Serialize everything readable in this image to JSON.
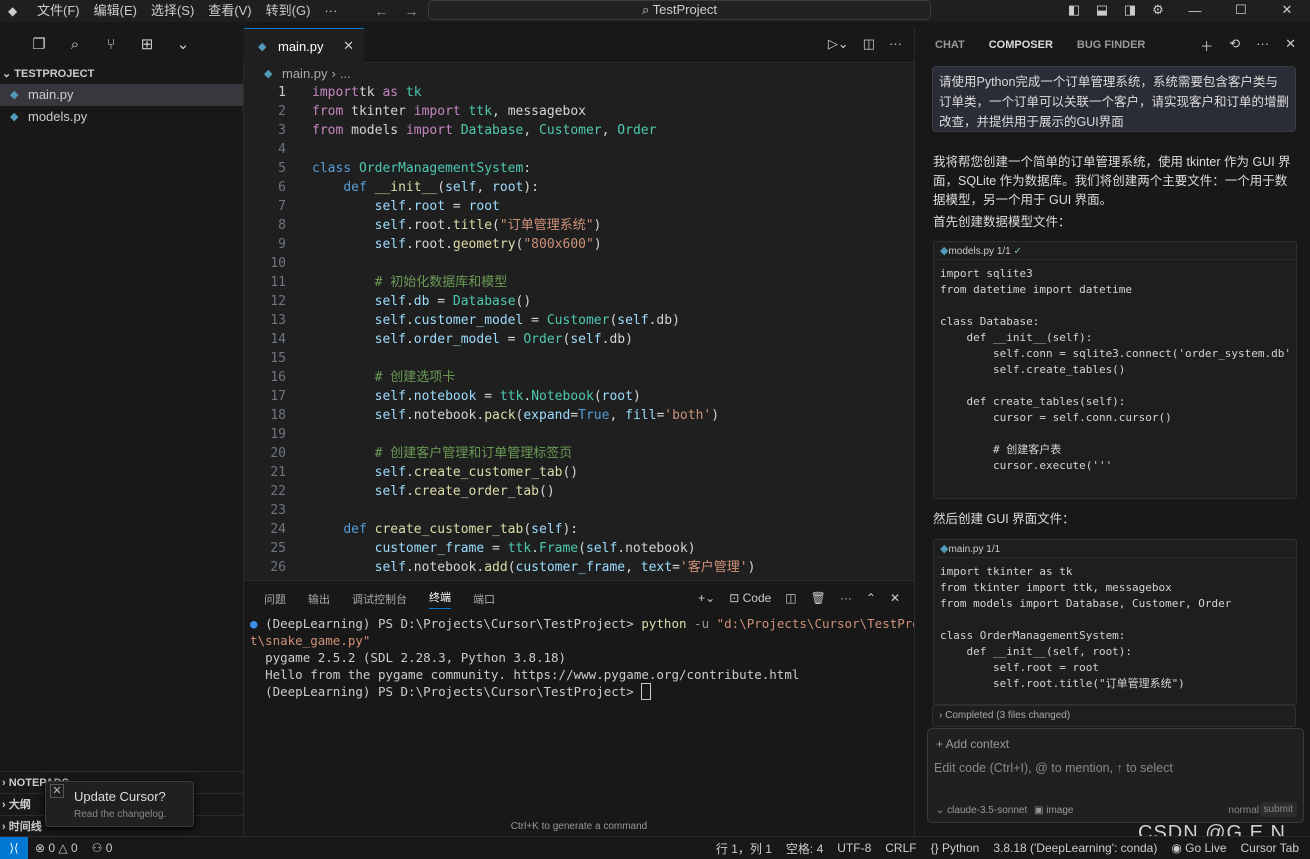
{
  "titlebar": {
    "menus": [
      "文件(F)",
      "编辑(E)",
      "选择(S)",
      "查看(V)",
      "转到(G)",
      "···"
    ],
    "search": "TestProject"
  },
  "sidebar": {
    "title": "TESTPROJECT",
    "files": [
      "main.py",
      "models.py"
    ],
    "sections": [
      "NOTEPADS",
      "大纲",
      "时间线"
    ]
  },
  "toast": {
    "title": "Update Cursor?",
    "subtitle": "Read the changelog."
  },
  "editor": {
    "tab": "main.py",
    "breadcrumb": "main.py",
    "breadcrumb_more": "...",
    "lines": [
      [
        [
          "kw",
          "import"
        ],
        [
          "",
          "tk"
        ],
        [
          "kw",
          " as"
        ],
        [
          "cls",
          " tk"
        ]
      ],
      [
        [
          "kw",
          "from"
        ],
        [
          "",
          " tkinter "
        ],
        [
          "kw",
          "import"
        ],
        [
          "cls",
          " ttk"
        ],
        [
          "",
          ", messagebox"
        ]
      ],
      [
        [
          "kw",
          "from"
        ],
        [
          "",
          " models "
        ],
        [
          "kw",
          "import"
        ],
        [
          "cls",
          " Database"
        ],
        [
          "",
          ", "
        ],
        [
          "cls",
          "Customer"
        ],
        [
          "",
          ", "
        ],
        [
          "cls",
          "Order"
        ]
      ],
      [],
      [
        [
          "kw2",
          "class"
        ],
        [
          "cls",
          " OrderManagementSystem"
        ],
        [
          "",
          ":"
        ]
      ],
      [
        [
          "",
          "    "
        ],
        [
          "kw2",
          "def"
        ],
        [
          "fn",
          " __init__"
        ],
        [
          "",
          "("
        ],
        [
          "var",
          "self"
        ],
        [
          "",
          ", "
        ],
        [
          "var",
          "root"
        ],
        [
          "",
          "):"
        ]
      ],
      [
        [
          "",
          "        "
        ],
        [
          "var",
          "self"
        ],
        [
          "",
          "."
        ],
        [
          "var",
          "root"
        ],
        [
          "",
          " = "
        ],
        [
          "var",
          "root"
        ]
      ],
      [
        [
          "",
          "        "
        ],
        [
          "var",
          "self"
        ],
        [
          "",
          ".root."
        ],
        [
          "fn",
          "title"
        ],
        [
          "",
          "("
        ],
        [
          "str",
          "\"订单管理系统\""
        ],
        [
          "",
          ")"
        ]
      ],
      [
        [
          "",
          "        "
        ],
        [
          "var",
          "self"
        ],
        [
          "",
          ".root."
        ],
        [
          "fn",
          "geometry"
        ],
        [
          "",
          "("
        ],
        [
          "str",
          "\"800x600\""
        ],
        [
          "",
          ")"
        ]
      ],
      [],
      [
        [
          "",
          "        "
        ],
        [
          "cm",
          "# 初始化数据库和模型"
        ]
      ],
      [
        [
          "",
          "        "
        ],
        [
          "var",
          "self"
        ],
        [
          "",
          "."
        ],
        [
          "var",
          "db"
        ],
        [
          "",
          " = "
        ],
        [
          "cls",
          "Database"
        ],
        [
          "",
          "()"
        ]
      ],
      [
        [
          "",
          "        "
        ],
        [
          "var",
          "self"
        ],
        [
          "",
          "."
        ],
        [
          "var",
          "customer_model"
        ],
        [
          "",
          " = "
        ],
        [
          "cls",
          "Customer"
        ],
        [
          "",
          "("
        ],
        [
          "var",
          "self"
        ],
        [
          "",
          ".db)"
        ]
      ],
      [
        [
          "",
          "        "
        ],
        [
          "var",
          "self"
        ],
        [
          "",
          "."
        ],
        [
          "var",
          "order_model"
        ],
        [
          "",
          " = "
        ],
        [
          "cls",
          "Order"
        ],
        [
          "",
          "("
        ],
        [
          "var",
          "self"
        ],
        [
          "",
          ".db)"
        ]
      ],
      [],
      [
        [
          "",
          "        "
        ],
        [
          "cm",
          "# 创建选项卡"
        ]
      ],
      [
        [
          "",
          "        "
        ],
        [
          "var",
          "self"
        ],
        [
          "",
          "."
        ],
        [
          "var",
          "notebook"
        ],
        [
          "",
          " = "
        ],
        [
          "cls",
          "ttk"
        ],
        [
          "",
          "."
        ],
        [
          "cls",
          "Notebook"
        ],
        [
          "",
          "("
        ],
        [
          "var",
          "root"
        ],
        [
          "",
          ")"
        ]
      ],
      [
        [
          "",
          "        "
        ],
        [
          "var",
          "self"
        ],
        [
          "",
          ".notebook."
        ],
        [
          "fn",
          "pack"
        ],
        [
          "",
          "("
        ],
        [
          "var",
          "expand"
        ],
        [
          "",
          "="
        ],
        [
          "kw2",
          "True"
        ],
        [
          "",
          ", "
        ],
        [
          "var",
          "fill"
        ],
        [
          "",
          "="
        ],
        [
          "str",
          "'both'"
        ],
        [
          "",
          ")"
        ]
      ],
      [],
      [
        [
          "",
          "        "
        ],
        [
          "cm",
          "# 创建客户管理和订单管理标签页"
        ]
      ],
      [
        [
          "",
          "        "
        ],
        [
          "var",
          "self"
        ],
        [
          "",
          "."
        ],
        [
          "fn",
          "create_customer_tab"
        ],
        [
          "",
          "()"
        ]
      ],
      [
        [
          "",
          "        "
        ],
        [
          "var",
          "self"
        ],
        [
          "",
          "."
        ],
        [
          "fn",
          "create_order_tab"
        ],
        [
          "",
          "()"
        ]
      ],
      [],
      [
        [
          "",
          "    "
        ],
        [
          "kw2",
          "def"
        ],
        [
          "fn",
          " create_customer_tab"
        ],
        [
          "",
          "("
        ],
        [
          "var",
          "self"
        ],
        [
          "",
          "):"
        ]
      ],
      [
        [
          "",
          "        "
        ],
        [
          "var",
          "customer_frame"
        ],
        [
          "",
          " = "
        ],
        [
          "cls",
          "ttk"
        ],
        [
          "",
          "."
        ],
        [
          "cls",
          "Frame"
        ],
        [
          "",
          "("
        ],
        [
          "var",
          "self"
        ],
        [
          "",
          ".notebook)"
        ]
      ],
      [
        [
          "",
          "        "
        ],
        [
          "var",
          "self"
        ],
        [
          "",
          ".notebook."
        ],
        [
          "fn",
          "add"
        ],
        [
          "",
          "("
        ],
        [
          "var",
          "customer_frame"
        ],
        [
          "",
          ", "
        ],
        [
          "var",
          "text"
        ],
        [
          "",
          "="
        ],
        [
          "str",
          "'客户管理'"
        ],
        [
          "",
          ")"
        ]
      ]
    ]
  },
  "panel": {
    "tabs": [
      "问题",
      "输出",
      "调试控制台",
      "终端",
      "端口"
    ],
    "active": "终端",
    "code_label": "Code",
    "terminal": [
      "(DeepLearning) PS D:\\Projects\\Cursor\\TestProject> ",
      "python",
      " -u ",
      "\"d:\\Projects\\Cursor\\TestProjec",
      "t\\snake_game.py\"",
      "pygame 2.5.2 (SDL 2.28.3, Python 3.8.18)",
      "Hello from the pygame community. https://www.pygame.org/contribute.html",
      "(DeepLearning) PS D:\\Projects\\Cursor\\TestProject> "
    ],
    "hint": "Ctrl+K to generate a command"
  },
  "chat": {
    "tabs": [
      "CHAT",
      "COMPOSER",
      "BUG FINDER"
    ],
    "active": "COMPOSER",
    "user_msg": "请使用Python完成一个订单管理系统，系统需要包含客户类与订单类，一个订单可以关联一个客户，请实现客户和订单的增删改查，并提供用于展示的GUI界面",
    "ai_intro": "我将帮您创建一个简单的订单管理系统，使用 tkinter 作为 GUI 界面，SQLite 作为数据库。我们将创建两个主要文件：一个用于数据模型，另一个用于 GUI 界面。",
    "ai_step1": "首先创建数据模型文件：",
    "block1": {
      "file": "models.py",
      "count": "1/1",
      "code": "import sqlite3\nfrom datetime import datetime\n\nclass Database:\n    def __init__(self):\n        self.conn = sqlite3.connect('order_system.db'\n        self.create_tables()\n\n    def create_tables(self):\n        cursor = self.conn.cursor()\n\n        # 创建客户表\n        cursor.execute('''"
    },
    "ai_step2": "然后创建 GUI 界面文件：",
    "block2": {
      "file": "main.py",
      "count": "1/1",
      "code": "import tkinter as tk\nfrom tkinter import ttk, messagebox\nfrom models import Database, Customer, Order\n\nclass OrderManagementSystem:\n    def __init__(self, root):\n        self.root = root\n        self.root.title(\"订单管理系统\")"
    },
    "completed": "Completed (3 files changed)",
    "add_context": "+ Add context",
    "placeholder": "Edit code (Ctrl+I), @ to mention, ↑ to select",
    "model": "claude-3.5-sonnet",
    "image": "image",
    "mode": "normal",
    "submit": "submit"
  },
  "status": {
    "errors": "0",
    "warnings": "0",
    "ports": "0",
    "position": "行 1，列 1",
    "spaces": "空格: 4",
    "encoding": "UTF-8",
    "eol": "CRLF",
    "lang": "Python",
    "interp": "3.8.18 ('DeepLearning': conda)",
    "golive": "Go Live",
    "cursortab": "Cursor Tab"
  },
  "watermark": "CSDN @G.E.N."
}
